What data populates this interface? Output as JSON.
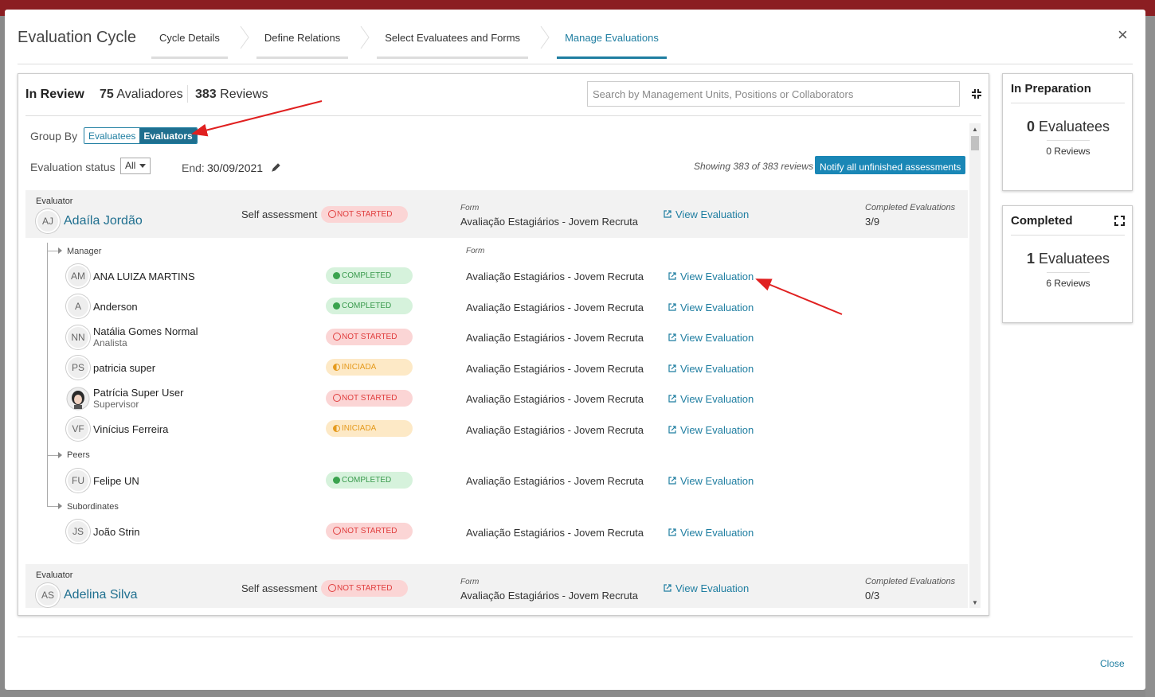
{
  "modal": {
    "title": "Evaluation Cycle",
    "steps": [
      "Cycle Details",
      "Define Relations",
      "Select Evaluatees and Forms",
      "Manage Evaluations"
    ],
    "active_step": "Manage Evaluations",
    "close_label": "Close"
  },
  "review": {
    "title": "In Review",
    "evaluators_count": "75",
    "evaluators_label": "Avaliadores",
    "reviews_count": "383",
    "reviews_label": "Reviews",
    "search_placeholder": "Search by Management Units, Positions or Collaborators",
    "group_by_label": "Group By",
    "group_options": [
      "Evaluatees",
      "Evaluators"
    ],
    "group_selected": "Evaluators",
    "status_label": "Evaluation status",
    "status_value": "All",
    "end_label": "End:",
    "end_value": "30/09/2021",
    "showing": "Showing 383 of 383 reviews",
    "notify_label": "Notify all unfinished assessments"
  },
  "labels": {
    "evaluator": "Evaluator",
    "self_assessment": "Self assessment",
    "form": "Form",
    "view_evaluation": "View Evaluation",
    "completed_evaluations": "Completed Evaluations"
  },
  "evaluators": [
    {
      "initials": "AJ",
      "name": "Adaíla Jordão",
      "self_status": "NOT STARTED",
      "form": "Avaliação Estagiários - Jovem Recruta",
      "completed": "3/9"
    },
    {
      "initials": "AS",
      "name": "Adelina Silva",
      "self_status": "NOT STARTED",
      "form": "Avaliação Estagiários - Jovem Recruta",
      "completed": "0/3"
    }
  ],
  "sections": [
    "Manager",
    "Peers",
    "Subordinates"
  ],
  "evaluatees": [
    {
      "initials": "AM",
      "name": "ANA LUIZA MARTINS",
      "sub": "",
      "status": "COMPLETED",
      "form": "Avaliação Estagiários - Jovem Recruta"
    },
    {
      "initials": "A",
      "name": "Anderson",
      "sub": "",
      "status": "COMPLETED",
      "form": "Avaliação Estagiários - Jovem Recruta"
    },
    {
      "initials": "NN",
      "name": "Natália Gomes Normal",
      "sub": "Analista",
      "status": "NOT STARTED",
      "form": "Avaliação Estagiários - Jovem Recruta"
    },
    {
      "initials": "PS",
      "name": "patricia super",
      "sub": "",
      "status": "INICIADA",
      "form": "Avaliação Estagiários - Jovem Recruta"
    },
    {
      "initials": "",
      "name": "Patrícia Super User",
      "sub": "Supervisor",
      "status": "NOT STARTED",
      "form": "Avaliação Estagiários - Jovem Recruta"
    },
    {
      "initials": "VF",
      "name": "Vinícius Ferreira",
      "sub": "",
      "status": "INICIADA",
      "form": "Avaliação Estagiários - Jovem Recruta"
    },
    {
      "initials": "FU",
      "name": "Felipe UN",
      "sub": "",
      "status": "COMPLETED",
      "form": "Avaliação Estagiários - Jovem Recruta"
    },
    {
      "initials": "JS",
      "name": "João Strin",
      "sub": "",
      "status": "NOT STARTED",
      "form": "Avaliação Estagiários - Jovem Recruta"
    }
  ],
  "preparation": {
    "title": "In Preparation",
    "evaluatees_count": "0",
    "evaluatees_label": "Evaluatees",
    "reviews": "0 Reviews"
  },
  "completed": {
    "title": "Completed",
    "evaluatees_count": "1",
    "evaluatees_label": "Evaluatees",
    "reviews": "6 Reviews"
  },
  "colors": {
    "accent": "#1f7ea1",
    "header_bar": "#8b1e22",
    "not_started": "#e03d3d",
    "completed": "#3aa34e",
    "iniciada": "#e59a1d",
    "annotation_arrow": "#e02020"
  }
}
